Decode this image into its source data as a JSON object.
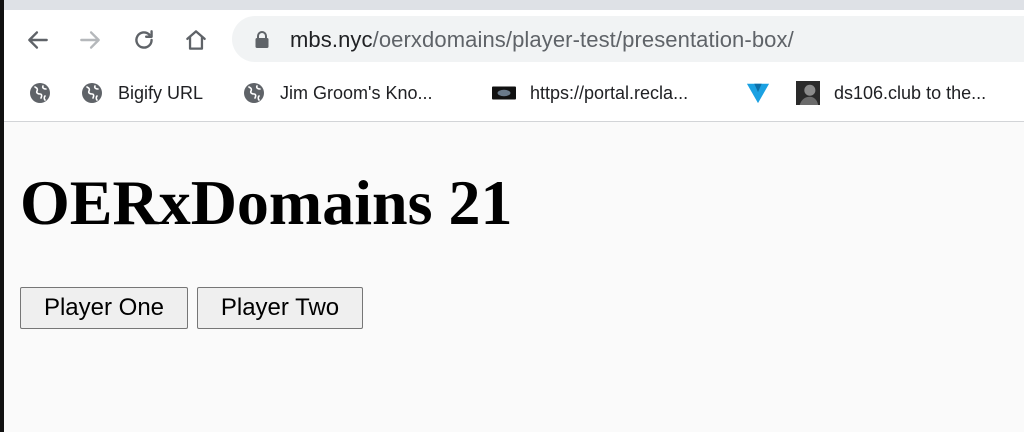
{
  "browser": {
    "url_host": "mbs.nyc",
    "url_path": "/oerxdomains/player-test/presentation-box/",
    "nav": {
      "back_icon": "arrow-left-icon",
      "forward_icon": "arrow-right-icon",
      "reload_icon": "reload-icon",
      "home_icon": "home-icon",
      "lock_icon": "lock-icon"
    },
    "bookmarks": [
      {
        "icon": "globe-icon",
        "label": ""
      },
      {
        "icon": "globe-icon",
        "label": "Bigify URL"
      },
      {
        "icon": "globe-icon",
        "label": "Jim Groom's Kno..."
      },
      {
        "icon": "reclaim-favicon-icon",
        "label": "https://portal.recla..."
      },
      {
        "icon": "triangle-logo-icon",
        "label": ""
      },
      {
        "icon": "photo-thumbnail-icon",
        "label": "ds106.club to the..."
      }
    ]
  },
  "page": {
    "title": "OERxDomains 21",
    "buttons": {
      "player_one": "Player One",
      "player_two": "Player Two"
    }
  },
  "colors": {
    "chrome_bg": "#ffffff",
    "omnibox_bg": "#f1f3f4",
    "page_bg": "#fafafa",
    "icon_color": "#5f6368",
    "triangle_logo": "#1ba1e2"
  }
}
